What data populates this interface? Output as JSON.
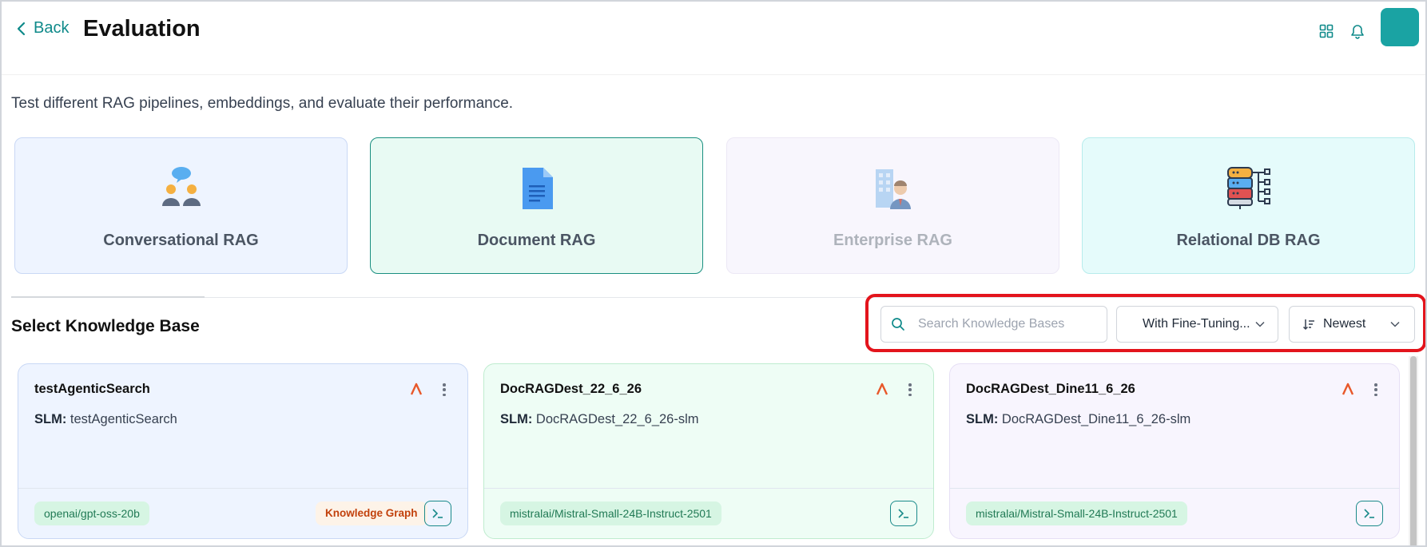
{
  "header": {
    "back_label": "Back",
    "title": "Evaluation",
    "icons": [
      "grid-icon",
      "bell-icon"
    ]
  },
  "subtitle": "Test different RAG pipelines, embeddings, and evaluate their performance.",
  "rag_types": [
    {
      "label": "Conversational RAG",
      "icon": "conversation-people-icon"
    },
    {
      "label": "Document RAG",
      "icon": "document-icon",
      "selected": true
    },
    {
      "label": "Enterprise RAG",
      "icon": "enterprise-person-icon",
      "disabled": true
    },
    {
      "label": "Relational DB RAG",
      "icon": "database-icon"
    }
  ],
  "knowledge_base": {
    "title": "Select Knowledge Base",
    "search_placeholder": "Search Knowledge Bases",
    "filter_value": "With Fine-Tuning...",
    "sort_value": "Newest"
  },
  "kb_cards": [
    {
      "name": "testAgenticSearch",
      "slm_label": "SLM:",
      "slm_value": "testAgenticSearch",
      "model": "openai/gpt-oss-20b",
      "tag": "Knowledge Graph"
    },
    {
      "name": "DocRAGDest_22_6_26",
      "slm_label": "SLM:",
      "slm_value": "DocRAGDest_22_6_26-slm",
      "model": "mistralai/Mistral-Small-24B-Instruct-2501"
    },
    {
      "name": "DocRAGDest_Dine11_6_26",
      "slm_label": "SLM:",
      "slm_value": "DocRAGDest_Dine11_6_26-slm",
      "model": "mistralai/Mistral-Small-24B-Instruct-2501"
    }
  ],
  "colors": {
    "accent": "#0f8a8a",
    "highlight": "#e3141c",
    "caret": "#e8582a"
  }
}
